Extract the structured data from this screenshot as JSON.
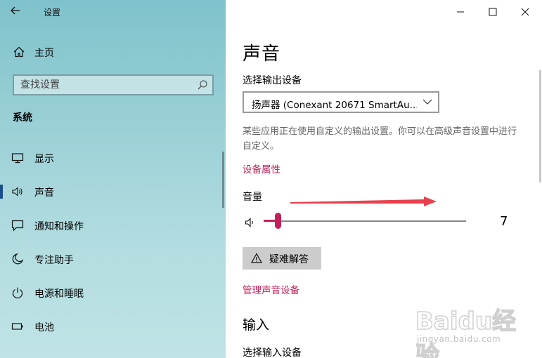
{
  "window": {
    "title": "设置"
  },
  "sidebar": {
    "home_label": "主页",
    "search_placeholder": "查找设置",
    "section_title": "系统",
    "items": [
      {
        "label": "显示",
        "icon": "monitor-icon"
      },
      {
        "label": "声音",
        "icon": "speaker-icon",
        "active": true
      },
      {
        "label": "通知和操作",
        "icon": "notification-icon"
      },
      {
        "label": "专注助手",
        "icon": "moon-icon"
      },
      {
        "label": "电源和睡眠",
        "icon": "power-icon"
      },
      {
        "label": "电池",
        "icon": "battery-icon"
      }
    ]
  },
  "main": {
    "page_title": "声音",
    "output_label": "选择输出设备",
    "output_device": "扬声器 (Conexant 20671 SmartAu...",
    "description": "某些应用正在使用自定义的输出设置。你可以在高级声音设置中进行自定义。",
    "device_properties_link": "设备属性",
    "volume_label": "音量",
    "volume_value": "7",
    "volume_fraction": 0.07,
    "troubleshoot_label": "疑难解答",
    "manage_devices_link": "管理声音设备",
    "input_title": "输入",
    "input_label": "选择输入设备"
  },
  "watermark": {
    "main": "Baidu经验",
    "sub": "jingyan.baidu.com"
  },
  "colors": {
    "accent": "#c3205a",
    "arrow": "#e8414e"
  }
}
